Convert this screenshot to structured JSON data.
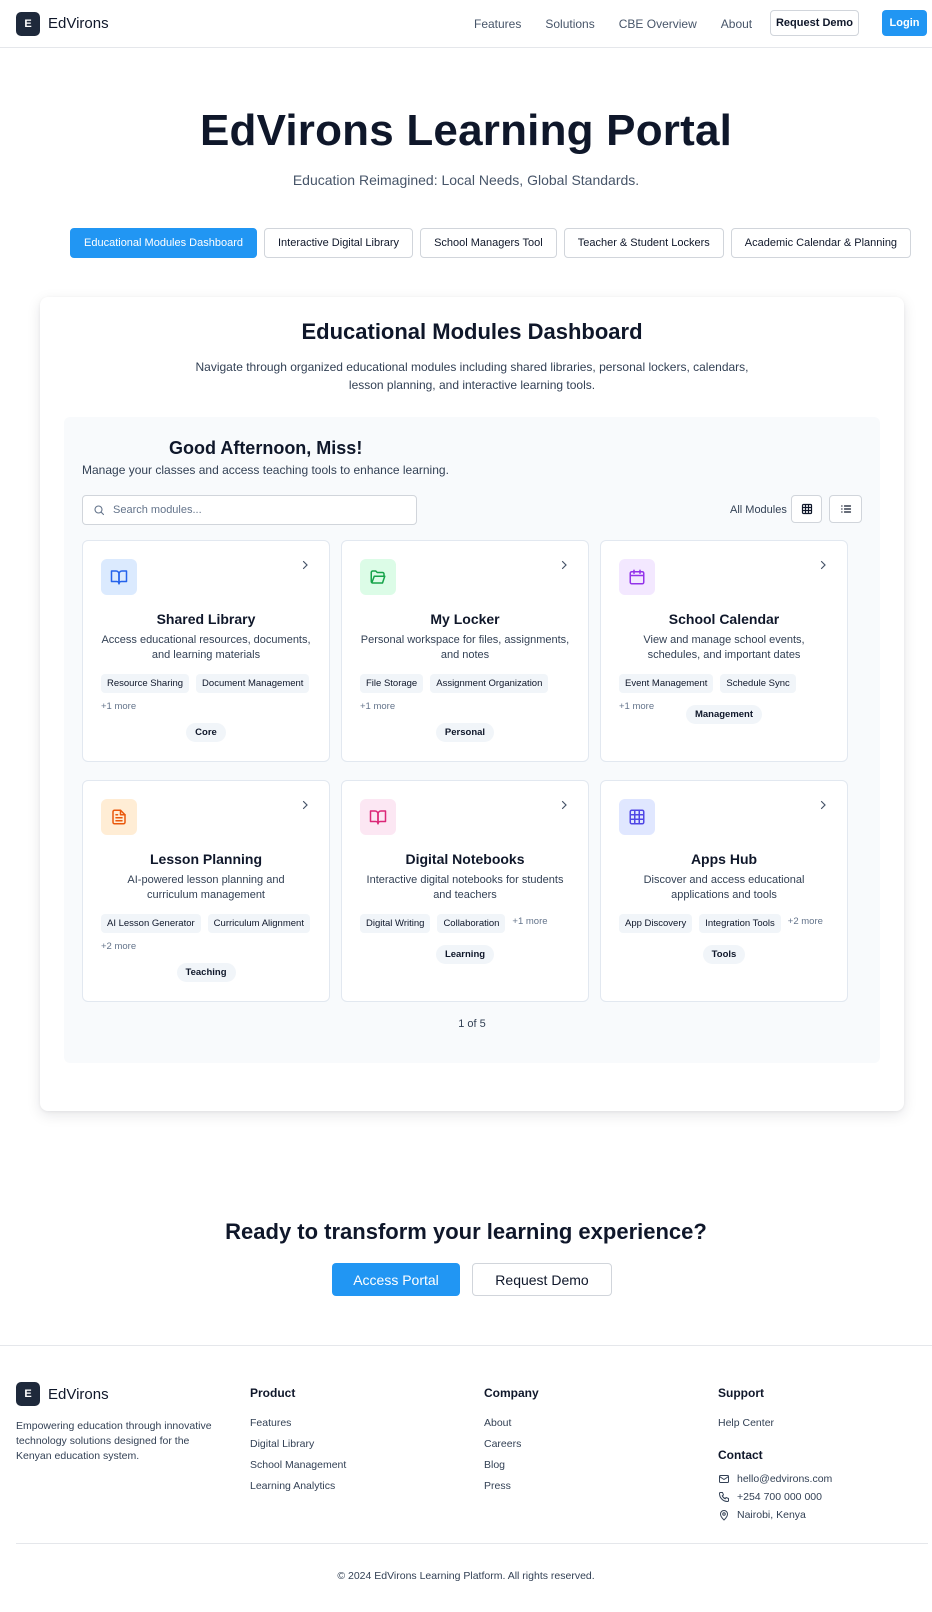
{
  "nav": {
    "logo_letter": "E",
    "logo_text": "EdVirons",
    "links": [
      "Features",
      "Solutions",
      "CBE Overview",
      "About"
    ],
    "request_demo": "Request Demo",
    "login": "Login"
  },
  "hero": {
    "title": "EdVirons Learning Portal",
    "subtitle": "Education Reimagined: Local Needs, Global Standards."
  },
  "tabs": [
    "Educational Modules Dashboard",
    "Interactive Digital Library",
    "School Managers Tool",
    "Teacher & Student Lockers",
    "Academic Calendar & Planning"
  ],
  "dashboard": {
    "title": "Educational Modules Dashboard",
    "description": "Navigate through organized educational modules including shared libraries, personal lockers, calendars, lesson planning, and interactive learning tools.",
    "greeting": "Good Afternoon, Miss!",
    "greeting_sub": "Manage your classes and access teaching tools to enhance learning.",
    "search_placeholder": "Search modules...",
    "view_label": "All Modules",
    "pager": "1 of 5",
    "modules": [
      {
        "title": "Shared Library",
        "description": "Access educational resources, documents, and learning materials",
        "tags": [
          "Resource Sharing",
          "Document Management"
        ],
        "more": "+1 more",
        "category": "Core",
        "icon": "book-icon",
        "color": "#2563eb",
        "bg": "#dbeafe"
      },
      {
        "title": "My Locker",
        "description": "Personal workspace for files, assignments, and notes",
        "tags": [
          "File Storage",
          "Assignment Organization"
        ],
        "more": "+1 more",
        "category": "Personal",
        "icon": "folder-icon",
        "color": "#16a34a",
        "bg": "#dcfce7"
      },
      {
        "title": "School Calendar",
        "description": "View and manage school events, schedules, and important dates",
        "tags": [
          "Event Management",
          "Schedule Sync"
        ],
        "more": "+1 more",
        "category": "Management",
        "icon": "calendar-icon",
        "color": "#9333ea",
        "bg": "#f3e8ff"
      },
      {
        "title": "Lesson Planning",
        "description": "AI-powered lesson planning and curriculum management",
        "tags": [
          "AI Lesson Generator",
          "Curriculum Alignment"
        ],
        "more": "+2 more",
        "category": "Teaching",
        "icon": "document-icon",
        "color": "#ea580c",
        "bg": "#ffedd5"
      },
      {
        "title": "Digital Notebooks",
        "description": "Interactive digital notebooks for students and teachers",
        "tags": [
          "Digital Writing",
          "Collaboration"
        ],
        "more": "+1 more",
        "category": "Learning",
        "icon": "notebook-icon",
        "color": "#db2777",
        "bg": "#fce7f3"
      },
      {
        "title": "Apps Hub",
        "description": "Discover and access educational applications and tools",
        "tags": [
          "App Discovery",
          "Integration Tools"
        ],
        "more": "+2 more",
        "category": "Tools",
        "icon": "grid-icon",
        "color": "#4f46e5",
        "bg": "#e0e7ff"
      }
    ]
  },
  "cta": {
    "title": "Ready to transform your learning experience?",
    "primary": "Access Portal",
    "secondary": "Request Demo"
  },
  "footer": {
    "logo_letter": "E",
    "logo_text": "EdVirons",
    "about": "Empowering education through innovative technology solutions designed for the Kenyan education system.",
    "product": {
      "heading": "Product",
      "items": [
        "Features",
        "Digital Library",
        "School Management",
        "Learning Analytics"
      ]
    },
    "company": {
      "heading": "Company",
      "items": [
        "About",
        "Careers",
        "Blog",
        "Press"
      ]
    },
    "support": {
      "heading": "Support",
      "items": [
        "Help Center"
      ]
    },
    "contact": {
      "heading": "Contact",
      "email": "hello@edvirons.com",
      "phone": "+254 700 000 000",
      "location": "Nairobi, Kenya"
    },
    "copyright": "© 2024 EdVirons Learning Platform. All rights reserved."
  }
}
